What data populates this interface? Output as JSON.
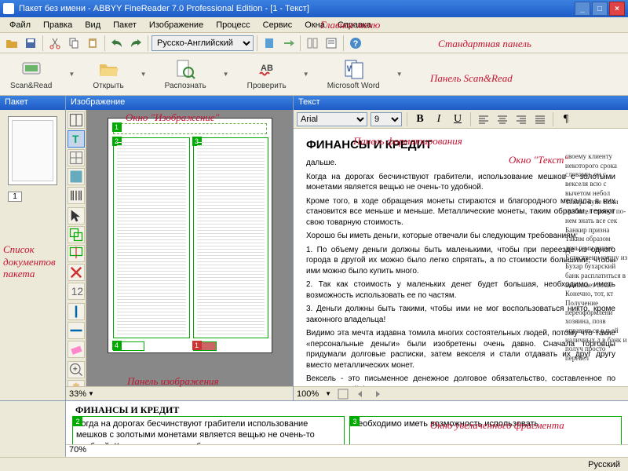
{
  "titlebar": {
    "text": "Пакет без имени - ABBYY FineReader 7.0 Professional Edition - [1 - Текст]"
  },
  "menu": {
    "items": [
      "Файл",
      "Правка",
      "Вид",
      "Пакет",
      "Изображение",
      "Процесс",
      "Сервис",
      "Окна",
      "Справка"
    ]
  },
  "toolbar": {
    "language": "Русско-Английский"
  },
  "scanread": {
    "items": [
      {
        "label": "Scan&Read"
      },
      {
        "label": "Открыть"
      },
      {
        "label": "Распознать"
      },
      {
        "label": "Проверить"
      },
      {
        "label": "Microsoft Word"
      }
    ]
  },
  "pakets": {
    "title": "Пакет",
    "thumb_num": "1"
  },
  "image": {
    "title": "Изображение",
    "zoom": "33%"
  },
  "text": {
    "title": "Текст",
    "font": "Arial",
    "size": "9",
    "heading": "ФИНАНСЫ И КРЕДИТ",
    "dalshie": "дальше.",
    "para1": "Когда на дорогах бесчинствуют грабители, использование мешков с золотыми монетами является вещью не очень-то удобной.",
    "para2": "Кроме того, в ходе обращения монеты стираются и благородного металла в них становится все меньше и меньше. Металлические монеты, таким образом, теряют свою товарную стоимость.",
    "para3": "Хорошо бы иметь деньги, которые отвечали бы следующим требованиям:",
    "para4": "1. По объему деньги должны быть маленькими, чтобы при переезде из одного города в другой их можно было легко спрятать, а по стоимости большими, чтобы ими можно было купить много.",
    "para5": "2. Так как стоимость у маленьких денег будет большая, необходимо иметь возможность использовать ее по частям.",
    "para6": "3. Деньги должны быть такими, чтобы ими не мог воспользоваться никто, кроме законного владельца!",
    "para7": "Видимо эта мечта издавна томила многих состоятельных людей, потому что такие «персональные деньги» были изобретены очень давно. Сначала торговцы придумали долговые расписки, затем векселя и стали отдавать их друг другу вместо металлических монет.",
    "para8": "Вексель - это письменное денежное долговое обязательство, составленное по определенной форме",
    "side": "своему клиенту некоторого срока словами, он с векселя всю с вычетом небол Теперь купе Если грабител смогут по-нем знать все сек Банкир призна Таким образом деньгами нашег Естественн купцу из Бухар бухарский банк расплатиться в возникает сомн Конечно, тот, кт Получение переоформлени хозяина, позв оправиться в п ей наличных д в банк и получ просто перевел",
    "zoom": "100%"
  },
  "zoomwin": {
    "title": "ФИНАНСЫ И КРЕДИТ",
    "col1": "Когда на дорогах бесчинствуют грабители использование мешков с золотыми монетами является вещью не очень-то удобной. Кроме того, в ходе обращения монеты стираются",
    "col2": "необходимо иметь возможность использовать",
    "zoom": "70%"
  },
  "status": {
    "lang": "Русский"
  },
  "annotations": {
    "main_menu": "Главное меню",
    "std_panel": "Стандартная панель",
    "scan_panel": "Панель Scan&Read",
    "image_win": "Окно \"Изображение\"",
    "fmt_panel": "Панель форматирования",
    "text_win": "Окно \"Текст\"",
    "image_panel": "Панель изображения",
    "doc_list": "Список документов пакета",
    "zoom_win": "Окно увеличенного фрагмента"
  }
}
